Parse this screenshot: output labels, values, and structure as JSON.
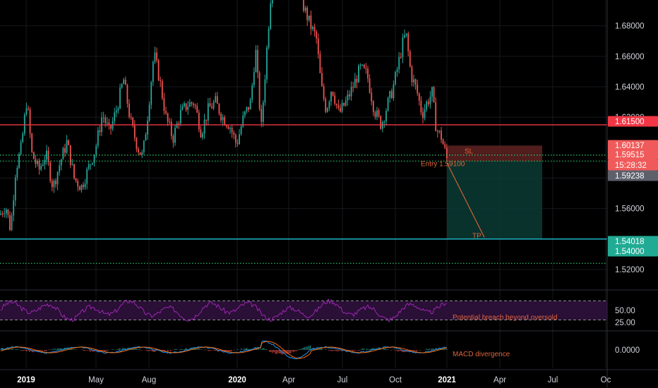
{
  "chart_data": {
    "type": "candlestick",
    "price_axis": {
      "ticks": [
        "1.68000",
        "1.66000",
        "1.64000",
        "1.62000",
        "1.56000",
        "1.52000"
      ],
      "range": [
        1.507,
        1.697
      ]
    },
    "time_axis": {
      "ticks": [
        {
          "label": "2019",
          "bold": true
        },
        {
          "label": "May",
          "bold": false
        },
        {
          "label": "Aug",
          "bold": false
        },
        {
          "label": "2020",
          "bold": true
        },
        {
          "label": "Apr",
          "bold": false
        },
        {
          "label": "Jul",
          "bold": false
        },
        {
          "label": "Oct",
          "bold": false
        },
        {
          "label": "2021",
          "bold": true
        },
        {
          "label": "Apr",
          "bold": false
        },
        {
          "label": "Jul",
          "bold": false
        },
        {
          "label": "Oc",
          "bold": false
        }
      ]
    },
    "price_tags": [
      {
        "label": "1.61500",
        "color": "#f23645"
      },
      {
        "label": "1.60137",
        "color": "#f05a5a"
      },
      {
        "label": "1.59515",
        "color": "#f05a5a"
      },
      {
        "label": "15:28:32",
        "color": "#f05a5a"
      },
      {
        "label": "1.59238",
        "color": "#5d606b"
      },
      {
        "label": "1.54018",
        "color": "#22ab94"
      },
      {
        "label": "1.54000",
        "color": "#22ab94"
      }
    ],
    "levels": {
      "resistance": 1.615,
      "support": 1.54,
      "dotted_upper": 1.5951,
      "dotted_mid": 1.5912,
      "dotted_lower": 1.524
    },
    "trade": {
      "stop_label": "SL",
      "entry_label": "Entry 1.59100",
      "target_label": "TP",
      "entry": 1.591,
      "stop": 1.6014,
      "target": 1.5402
    },
    "series_path": [
      [
        0,
        1.556
      ],
      [
        8,
        1.562
      ],
      [
        15,
        1.546
      ],
      [
        22,
        1.585
      ],
      [
        30,
        1.6
      ],
      [
        38,
        1.632
      ],
      [
        45,
        1.596
      ],
      [
        55,
        1.585
      ],
      [
        65,
        1.596
      ],
      [
        75,
        1.574
      ],
      [
        85,
        1.59
      ],
      [
        95,
        1.604
      ],
      [
        105,
        1.58
      ],
      [
        115,
        1.574
      ],
      [
        125,
        1.586
      ],
      [
        135,
        1.599
      ],
      [
        145,
        1.622
      ],
      [
        155,
        1.61
      ],
      [
        165,
        1.625
      ],
      [
        175,
        1.645
      ],
      [
        185,
        1.617
      ],
      [
        195,
        1.6
      ],
      [
        202,
        1.594
      ],
      [
        210,
        1.625
      ],
      [
        218,
        1.662
      ],
      [
        226,
        1.645
      ],
      [
        235,
        1.62
      ],
      [
        245,
        1.606
      ],
      [
        255,
        1.622
      ],
      [
        265,
        1.628
      ],
      [
        275,
        1.63
      ],
      [
        285,
        1.61
      ],
      [
        295,
        1.625
      ],
      [
        305,
        1.63
      ],
      [
        315,
        1.62
      ],
      [
        325,
        1.615
      ],
      [
        335,
        1.602
      ],
      [
        345,
        1.62
      ],
      [
        355,
        1.63
      ],
      [
        362,
        1.665
      ],
      [
        370,
        1.612
      ],
      [
        378,
        1.665
      ],
      [
        385,
        1.71
      ],
      [
        392,
        1.712
      ],
      [
        400,
        1.705
      ],
      [
        408,
        1.712
      ],
      [
        415,
        1.715
      ],
      [
        425,
        1.7
      ],
      [
        432,
        1.69
      ],
      [
        440,
        1.68
      ],
      [
        448,
        1.672
      ],
      [
        455,
        1.64
      ],
      [
        462,
        1.625
      ],
      [
        470,
        1.64
      ],
      [
        480,
        1.622
      ],
      [
        490,
        1.63
      ],
      [
        500,
        1.64
      ],
      [
        510,
        1.652
      ],
      [
        520,
        1.648
      ],
      [
        530,
        1.625
      ],
      [
        540,
        1.615
      ],
      [
        550,
        1.63
      ],
      [
        556,
        1.638
      ],
      [
        562,
        1.65
      ],
      [
        570,
        1.668
      ],
      [
        575,
        1.675
      ],
      [
        582,
        1.648
      ],
      [
        590,
        1.638
      ],
      [
        598,
        1.622
      ],
      [
        605,
        1.63
      ],
      [
        612,
        1.636
      ],
      [
        618,
        1.612
      ],
      [
        625,
        1.607
      ],
      [
        633,
        1.5924
      ]
    ],
    "rsi": {
      "ticks": [
        "50.00",
        "25.00"
      ],
      "range": [
        10,
        90
      ],
      "overbought": 70,
      "oversold": 30,
      "annotation": "Potential breach beyond oversold"
    },
    "macd": {
      "ticks": [
        "0.0000"
      ],
      "annotation": "MACD divergence"
    }
  },
  "colors": {
    "background": "#000000",
    "up_candle": "#26a69a",
    "down_candle": "#ef5350",
    "resistance_line": "#f23645",
    "support_line": "#22c3d6",
    "dotted_line": "#2ecc71",
    "stop_zone": "#5a2020",
    "profit_zone": "#0b3b34",
    "rsi_line": "#9c27b0",
    "rsi_band": "#2a0f36",
    "macd_line": "#2196f3",
    "signal_line": "#ff6d00",
    "annotation": "#e0643c"
  }
}
